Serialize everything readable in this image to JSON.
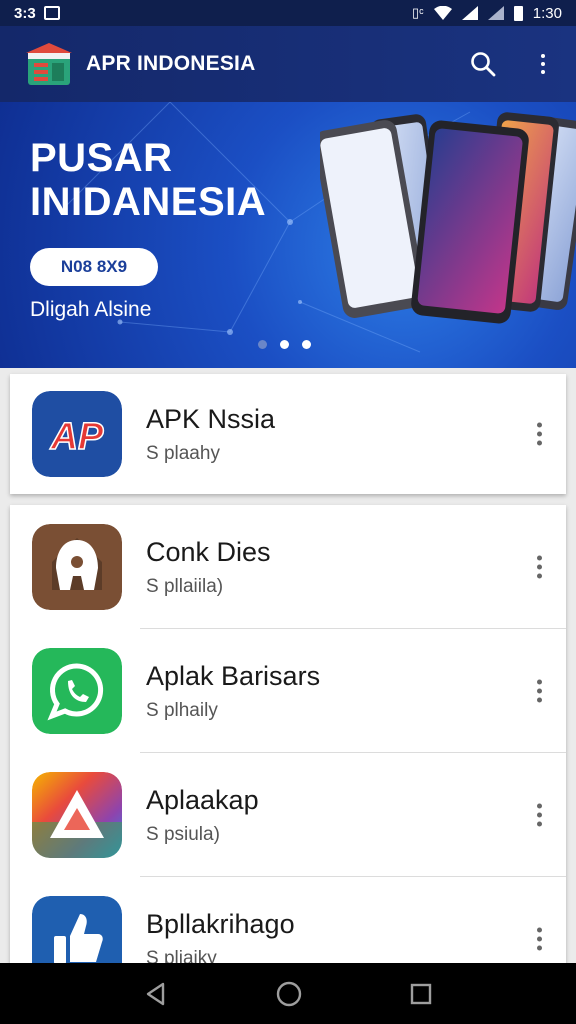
{
  "status_bar": {
    "left_text": "3:3",
    "time": "1:30",
    "icons": [
      "image-icon",
      "vibrate-icon",
      "wifi-icon",
      "signal-icon",
      "signal-icon",
      "battery-icon"
    ]
  },
  "app_bar": {
    "title": "APR INDONESIA",
    "logo": "store-logo",
    "actions": [
      "search-icon",
      "more-vert-icon"
    ]
  },
  "banner": {
    "title_line1": "PUSAR",
    "title_line2": "INIDANESIA",
    "pill_label": "N08 8X9",
    "subtitle": "Dligah Alsine",
    "page_count": 3,
    "active_page": 2
  },
  "apps": [
    {
      "name": "APK Nssia",
      "subtitle": "S plaahy",
      "icon": "ap-logo-icon",
      "color": "#1f4ea3"
    },
    {
      "name": "Conk Dies",
      "subtitle": "S pllaiila)",
      "icon": "a-letter-icon",
      "color": "#7a4f34"
    },
    {
      "name": "Aplak Barisars",
      "subtitle": "S plhaily",
      "icon": "whatsapp-icon",
      "color": "#25b85a"
    },
    {
      "name": "Aplaakap",
      "subtitle": "S psiula)",
      "icon": "triangle-logo-icon",
      "color": "#e94b3c"
    },
    {
      "name": "Bpllakrihago",
      "subtitle": "S pliaiky",
      "icon": "thumbs-up-icon",
      "color": "#1f5fb0"
    }
  ],
  "nav_bar": [
    "back-icon",
    "home-icon",
    "recents-icon"
  ],
  "colors": {
    "app_bar": "#14286a",
    "banner": "#1b4fc4",
    "card": "#ffffff"
  }
}
